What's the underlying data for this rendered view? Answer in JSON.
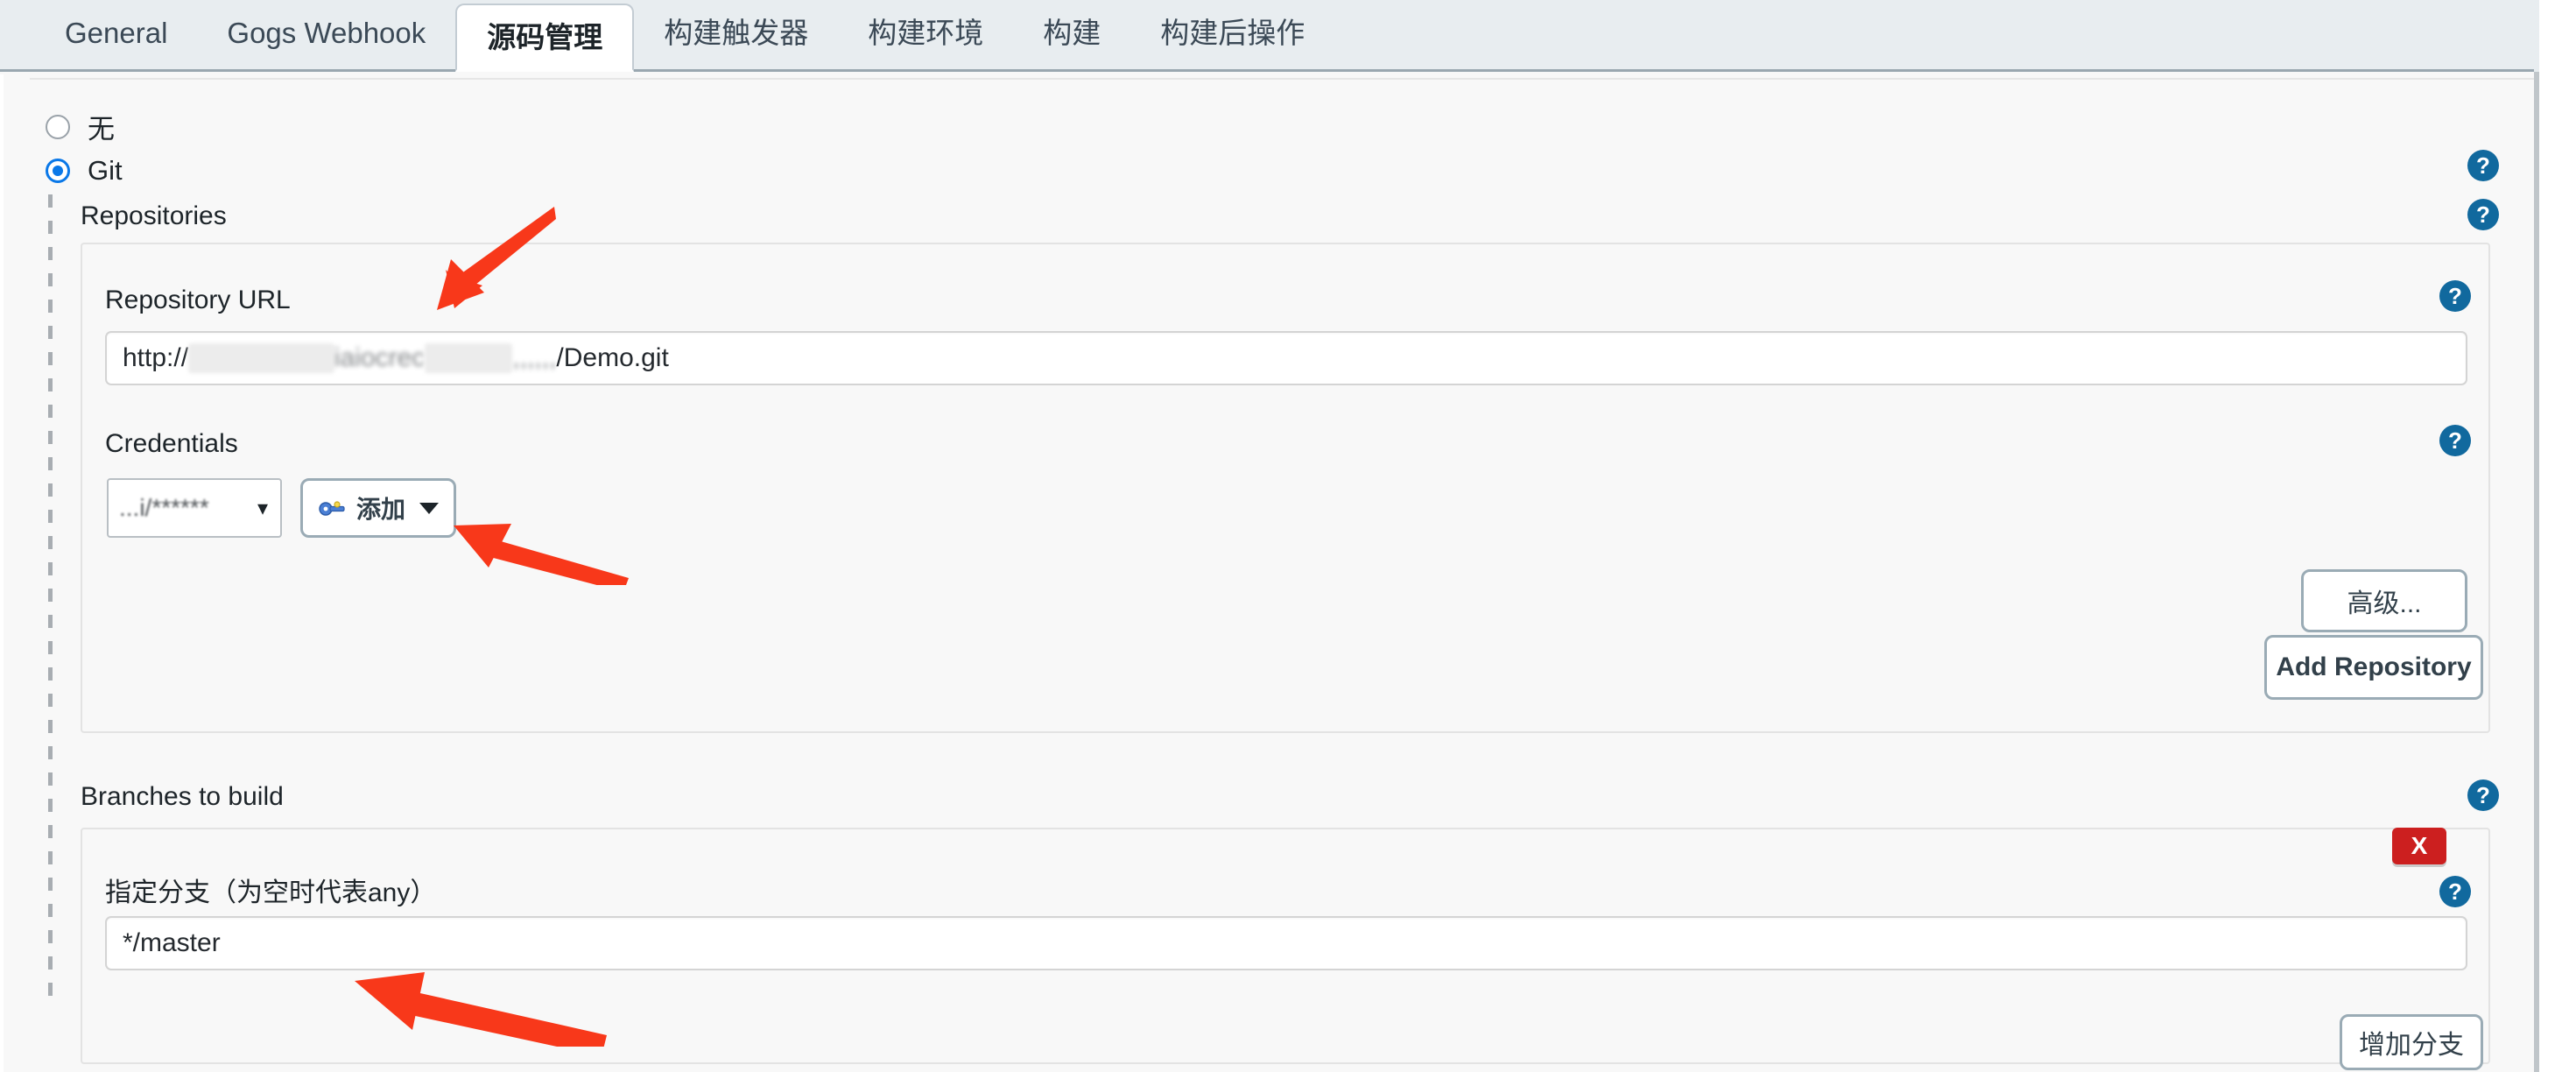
{
  "tabs": [
    {
      "label": "General",
      "active": false
    },
    {
      "label": "Gogs Webhook",
      "active": false
    },
    {
      "label": "源码管理",
      "active": true
    },
    {
      "label": "构建触发器",
      "active": false
    },
    {
      "label": "构建环境",
      "active": false
    },
    {
      "label": "构建",
      "active": false
    },
    {
      "label": "构建后操作",
      "active": false
    }
  ],
  "scm": {
    "options": [
      {
        "label": "无",
        "checked": false
      },
      {
        "label": "Git",
        "checked": true
      }
    ]
  },
  "repositories": {
    "heading": "Repositories",
    "repository_url": {
      "label": "Repository URL",
      "value_prefix": "http://",
      "value_redacted_1": "uuuuuuuuuu",
      "value_blurred": "iaiocrec",
      "value_redacted_2": "uuuuuu",
      "value_suffix": "/Demo.git",
      "value": "http://...../Demo.git"
    },
    "credentials": {
      "label": "Credentials",
      "selected": "...i/******",
      "add_button": "添加",
      "add_icon": "key-icon",
      "chevron": "chevron-down-icon"
    },
    "advanced_button": "高级...",
    "add_repository_button": "Add Repository"
  },
  "branches": {
    "heading": "Branches to build",
    "branch_spec": {
      "label": "指定分支（为空时代表any）",
      "value": "*/master"
    },
    "delete_badge": "X",
    "add_branch_button": "增加分支"
  },
  "help_icon_label": "?",
  "colors": {
    "accent_blue": "#0a78e8",
    "help_blue": "#11699e",
    "danger_red": "#cc1f1f",
    "arrow_red": "#f8381a",
    "tabbar_bg": "#e8edf0",
    "page_bg": "#f8f8f8"
  }
}
